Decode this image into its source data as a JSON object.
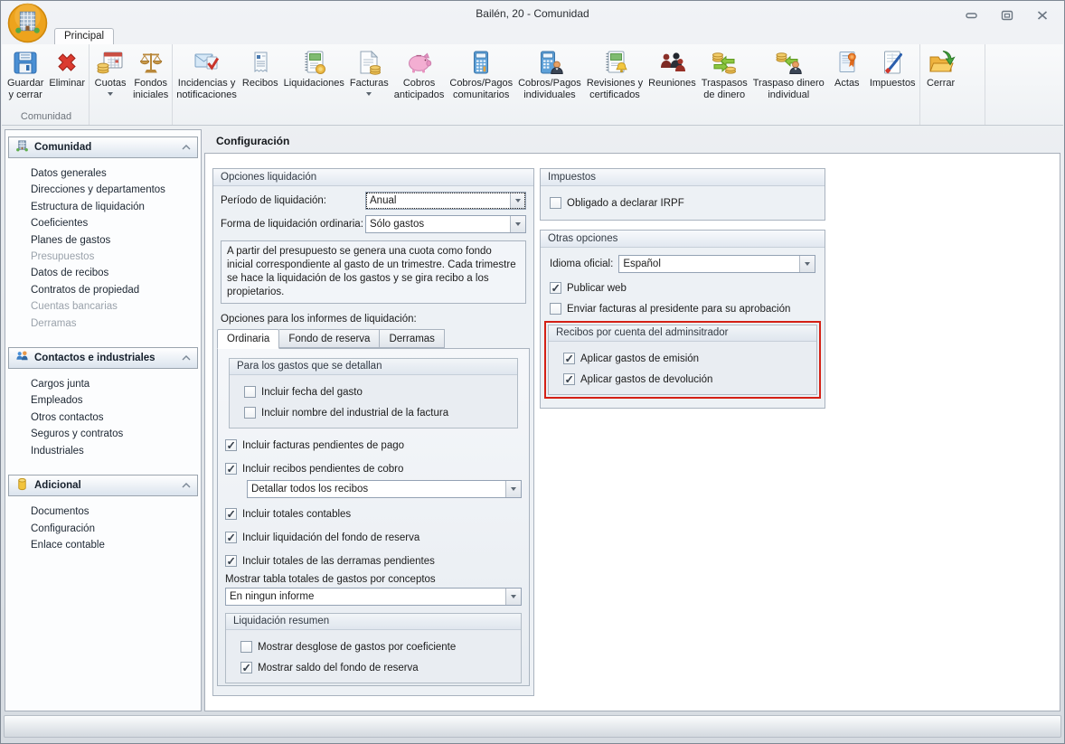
{
  "window": {
    "title": "Bailén, 20 - Comunidad",
    "tab": "Principal"
  },
  "ribbon": {
    "group_caption": "Comunidad",
    "buttons": [
      {
        "label": "Guardar\ny cerrar"
      },
      {
        "label": "Eliminar"
      },
      {
        "label": "Cuotas"
      },
      {
        "label": "Fondos\niniciales"
      },
      {
        "label": "Incidencias y\nnotificaciones"
      },
      {
        "label": "Recibos"
      },
      {
        "label": "Liquidaciones"
      },
      {
        "label": "Facturas"
      },
      {
        "label": "Cobros\nanticipados"
      },
      {
        "label": "Cobros/Pagos\ncomunitarios"
      },
      {
        "label": "Cobros/Pagos\nindividuales"
      },
      {
        "label": "Revisiones y\ncertificados"
      },
      {
        "label": "Reuniones"
      },
      {
        "label": "Traspasos\nde dinero"
      },
      {
        "label": "Traspaso dinero\nindividual"
      },
      {
        "label": "Actas"
      },
      {
        "label": "Impuestos"
      },
      {
        "label": "Cerrar"
      }
    ]
  },
  "sidebar": {
    "sections": [
      {
        "title": "Comunidad",
        "items": [
          {
            "label": "Datos generales"
          },
          {
            "label": "Direcciones y departamentos"
          },
          {
            "label": "Estructura de liquidación"
          },
          {
            "label": "Coeficientes"
          },
          {
            "label": "Planes de gastos"
          },
          {
            "label": "Presupuestos",
            "dim": true
          },
          {
            "label": "Datos de recibos"
          },
          {
            "label": "Contratos de propiedad"
          },
          {
            "label": "Cuentas bancarias",
            "dim": true
          },
          {
            "label": "Derramas",
            "dim": true
          }
        ]
      },
      {
        "title": "Contactos e industriales",
        "items": [
          {
            "label": "Cargos junta"
          },
          {
            "label": "Empleados"
          },
          {
            "label": "Otros contactos"
          },
          {
            "label": "Seguros y contratos"
          },
          {
            "label": "Industriales"
          }
        ]
      },
      {
        "title": "Adicional",
        "items": [
          {
            "label": "Documentos"
          },
          {
            "label": "Configuración"
          },
          {
            "label": "Enlace contable"
          }
        ]
      }
    ]
  },
  "main": {
    "page_title": "Configuración",
    "opciones": {
      "title": "Opciones liquidación",
      "periodo": {
        "label": "Período de liquidación:",
        "value": "Anual"
      },
      "forma": {
        "label": "Forma de liquidación ordinaria:",
        "value": "Sólo gastos"
      },
      "descripcion": "A partir del presupuesto se genera una cuota como fondo inicial correspondiente al gasto de un trimestre. Cada trimestre se hace la liquidación de los gastos y se gira recibo a los propietarios.",
      "informes_label": "Opciones para los informes de liquidación:",
      "tabs": [
        {
          "label": "Ordinaria"
        },
        {
          "label": "Fondo de reserva"
        },
        {
          "label": "Derramas"
        }
      ],
      "grupo_gastos": {
        "title": "Para los gastos que se detallan",
        "cb_fecha": {
          "label": "Incluir fecha del gasto",
          "checked": false
        },
        "cb_nombre": {
          "label": "Incluir nombre del industrial de la factura",
          "checked": false
        }
      },
      "cb_facturas_pendientes": {
        "label": "Incluir facturas pendientes de pago",
        "checked": true
      },
      "cb_recibos_pendientes": {
        "label": "Incluir recibos pendientes de cobro",
        "checked": true
      },
      "dd_detalle_recibos": {
        "value": "Detallar todos los recibos"
      },
      "cb_totales_contables": {
        "label": "Incluir totales contables",
        "checked": true
      },
      "cb_liquidacion_fondo": {
        "label": "Incluir liquidación del fondo de reserva",
        "checked": true
      },
      "cb_totales_derramas": {
        "label": "Incluir totales de las derramas pendientes",
        "checked": true
      },
      "mostrar_label": "Mostrar tabla totales de gastos por conceptos",
      "dd_mostrar": {
        "value": "En ningun informe"
      },
      "resumen": {
        "title": "Liquidación resumen",
        "cb_desglose": {
          "label": "Mostrar desglose de gastos por coeficiente",
          "checked": false
        },
        "cb_saldo": {
          "label": "Mostrar saldo del fondo de reserva",
          "checked": true
        }
      }
    },
    "impuestos": {
      "title": "Impuestos",
      "cb_irpf": {
        "label": "Obligado a declarar IRPF",
        "checked": false
      }
    },
    "otras": {
      "title": "Otras opciones",
      "idioma": {
        "label": "Idioma oficial:",
        "value": "Español"
      },
      "cb_publicar_web": {
        "label": "Publicar web",
        "checked": true
      },
      "cb_enviar_facturas": {
        "label": "Enviar facturas al presidente para su aprobación",
        "checked": false
      },
      "recibos_admin": {
        "title": "Recibos por cuenta del adminsitrador",
        "cb_emision": {
          "label": "Aplicar gastos de emisión",
          "checked": true
        },
        "cb_devolucion": {
          "label": "Aplicar gastos de devolución",
          "checked": true
        }
      }
    }
  },
  "colors": {
    "highlight_red": "#d42015",
    "accent_blue": "#4a8fd4",
    "chrome": "#e4e8ec"
  }
}
